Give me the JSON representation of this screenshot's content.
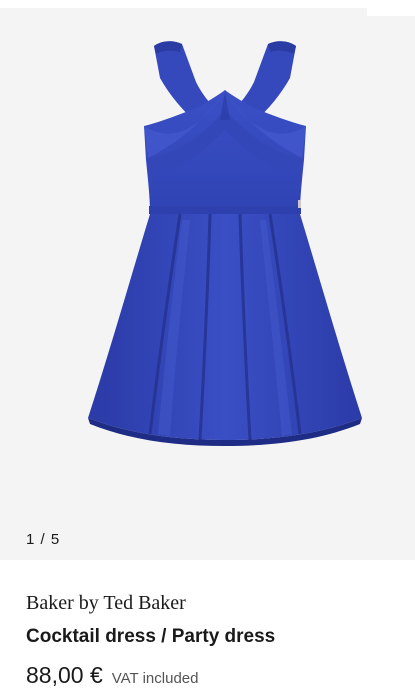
{
  "gallery": {
    "image_alt": "Cocktail dress / Party dress",
    "current_index": 1,
    "total": 5,
    "counter_label": "1 / 5"
  },
  "product": {
    "brand": "Baker by Ted Baker",
    "title": "Cocktail dress / Party dress",
    "price": "88,00 €",
    "vat_note": "VAT included"
  },
  "colors": {
    "gallery_background": "#f4f4f4",
    "dress_primary": "#3347b8",
    "dress_shadow": "#25339a",
    "dress_highlight": "#4a5fd0",
    "text": "#1a1a1a",
    "muted_text": "#555555"
  }
}
